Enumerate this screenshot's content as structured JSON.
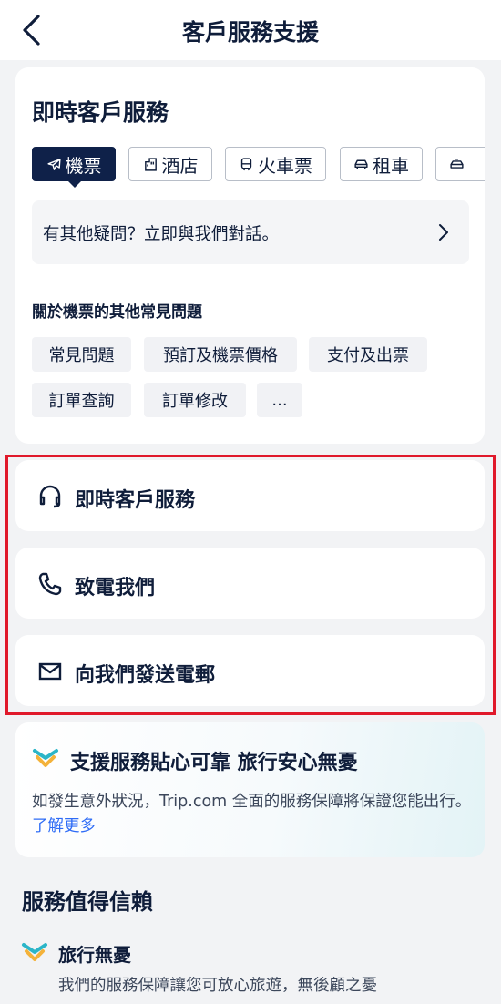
{
  "header": {
    "title": "客戶服務支援"
  },
  "live_service": {
    "title": "即時客戶服務",
    "tabs": [
      {
        "label": "機票",
        "icon": "plane-icon",
        "active": true
      },
      {
        "label": "酒店",
        "icon": "hotel-icon",
        "active": false
      },
      {
        "label": "火車票",
        "icon": "train-icon",
        "active": false
      },
      {
        "label": "租車",
        "icon": "car-icon",
        "active": false
      },
      {
        "label": "",
        "icon": "taxi-icon",
        "active": false
      }
    ],
    "chat_prompt": "有其他疑問？立即與我們對話。",
    "faq_title": "關於機票的其他常見問題",
    "faq_chips": [
      "常見問題",
      "預訂及機票價格",
      "支付及出票",
      "訂單查詢",
      "訂單修改",
      "..."
    ]
  },
  "contact_options": [
    {
      "label": "即時客戶服務",
      "icon": "headset-icon"
    },
    {
      "label": "致電我們",
      "icon": "phone-icon"
    },
    {
      "label": "向我們發送電郵",
      "icon": "mail-icon"
    }
  ],
  "promo": {
    "title": "支援服務貼心可靠 旅行安心無憂",
    "description": "如發生意外狀況，Trip.com 全面的服務保障將保證您能出行。",
    "link": "了解更多"
  },
  "trust": {
    "title": "服務值得信賴",
    "items": [
      {
        "title": "旅行無憂",
        "description": "我們的服務保障讓您可放心旅遊，無後顧之憂"
      }
    ]
  },
  "colors": {
    "navy": "#0f2149",
    "accent_red": "#e0192b",
    "link_blue": "#2e6cf6",
    "shield_teal": "#2bb5c8",
    "shield_gold": "#f4b23a"
  }
}
